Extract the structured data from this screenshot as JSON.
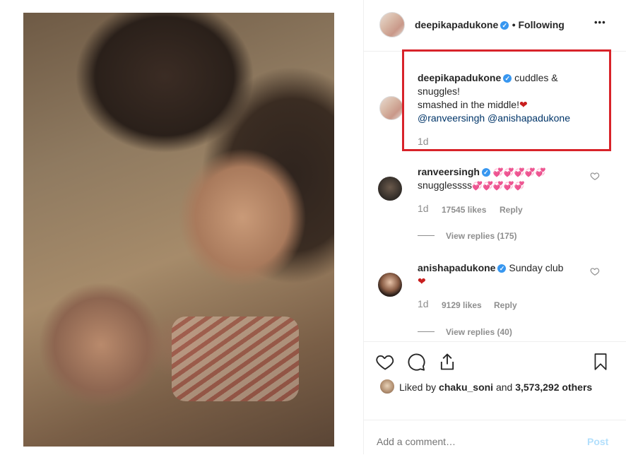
{
  "post": {
    "photo_alt": "",
    "author": "deepikapadukone",
    "follow_status": "• Following",
    "more_glyph": "•••"
  },
  "caption": {
    "username": "deepikapadukone",
    "line1": "cuddles &",
    "line2": "snuggles!",
    "line3": "smashed in the middle!",
    "line3_emoji": "❤",
    "mentions": "@ranveersingh @anishapadukone",
    "time": "1d"
  },
  "comments": [
    {
      "username": "ranveersingh",
      "hearts_line1": "💞💞💞💞💞",
      "text_line2": "snugglessss",
      "hearts_line2": "💞💞💞💞💞",
      "time": "1d",
      "likes": "17545 likes",
      "reply": "Reply",
      "view_replies": "View replies (175)"
    },
    {
      "username": "anishapadukone",
      "text_line1": "Sunday club",
      "text_line2": "❤",
      "time": "1d",
      "likes": "9129 likes",
      "reply": "Reply",
      "view_replies": "View replies (40)"
    }
  ],
  "likes": {
    "prefix": "Liked by ",
    "user": "chaku_soni",
    "middle": " and ",
    "count": "3,573,292 others"
  },
  "composer": {
    "placeholder": "Add a comment…",
    "post_label": "Post"
  },
  "colors": {
    "accent": "#3897f0",
    "highlight": "#d8232a",
    "heart": "#c81e1e"
  },
  "icons": [
    "heart-icon",
    "comment-icon",
    "share-icon",
    "bookmark-icon",
    "more-icon",
    "verified-icon"
  ]
}
